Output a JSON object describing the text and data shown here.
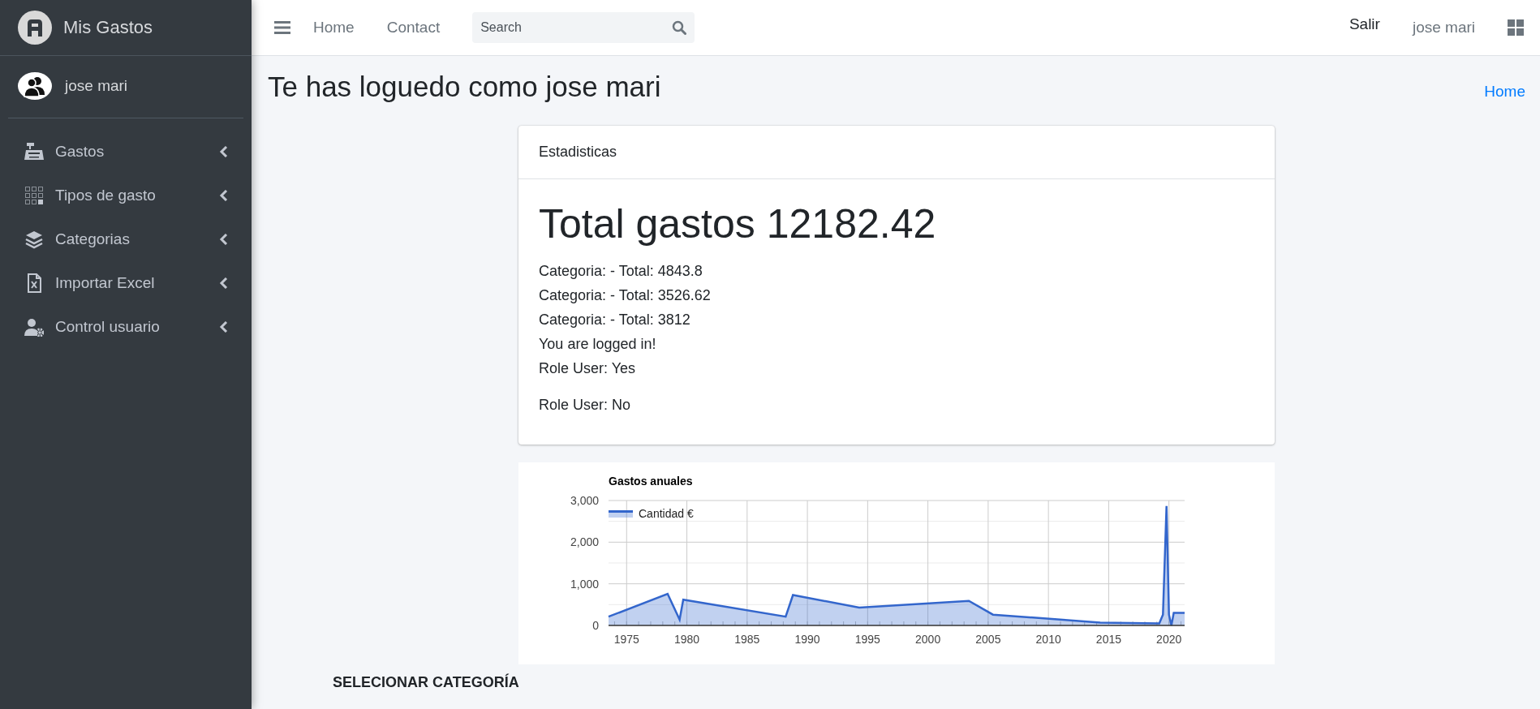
{
  "sidebar": {
    "brand": "Mis Gastos",
    "user": "jose mari",
    "items": [
      {
        "label": "Gastos",
        "expanded": false
      },
      {
        "label": "Tipos de gasto",
        "expanded": false
      },
      {
        "label": "Categorias",
        "expanded": false
      },
      {
        "label": "Importar Excel",
        "expanded": false
      },
      {
        "label": "Control usuario",
        "expanded": false
      }
    ]
  },
  "topbar": {
    "nav": [
      "Home",
      "Contact"
    ],
    "search": {
      "placeholder": "Search"
    },
    "logout": "Salir",
    "user": "jose mari"
  },
  "page": {
    "title": "Te has loguedo como jose mari",
    "breadcrumb": "Home"
  },
  "card": {
    "header": "Estadisticas",
    "total": "Total gastos 12182.42",
    "lines": [
      "Categoria: - Total: 4843.8",
      "Categoria: - Total: 3526.62",
      "Categoria: - Total: 3812",
      "You are logged in!",
      "Role User: Yes"
    ],
    "note": "Role User: No"
  },
  "chart_panel": {
    "chart_data": {
      "type": "area",
      "title": "Gastos anuales",
      "x": [
        1973.5,
        1978.4,
        1979.4,
        1979.7,
        1988.2,
        1988.8,
        1994.3,
        2003.4,
        2005.4,
        2014.3,
        2019.2,
        2019.5,
        2019.8,
        2020,
        2020.2,
        2020.4,
        2021.3
      ],
      "series": [
        {
          "name": "Cantidad €",
          "color": "#3366cc",
          "values": [
            210,
            760,
            140,
            620,
            210,
            730,
            430,
            590,
            260,
            70,
            50,
            260,
            2870,
            260,
            0,
            300,
            300
          ]
        }
      ],
      "grid": true,
      "xlim": [
        1973.5,
        2021.3
      ],
      "ylim": [
        0,
        3000
      ],
      "xticks": [
        1975,
        1980,
        1985,
        1990,
        1995,
        2000,
        2005,
        2010,
        2015,
        2020
      ],
      "yticks": [
        {
          "value": 0,
          "label": "0"
        },
        {
          "value": 1000,
          "label": "1,000"
        },
        {
          "value": 2000,
          "label": "2,000"
        },
        {
          "value": 3000,
          "label": "3,000"
        }
      ]
    }
  },
  "section_heading": "SELECIONAR CATEGORÍA"
}
